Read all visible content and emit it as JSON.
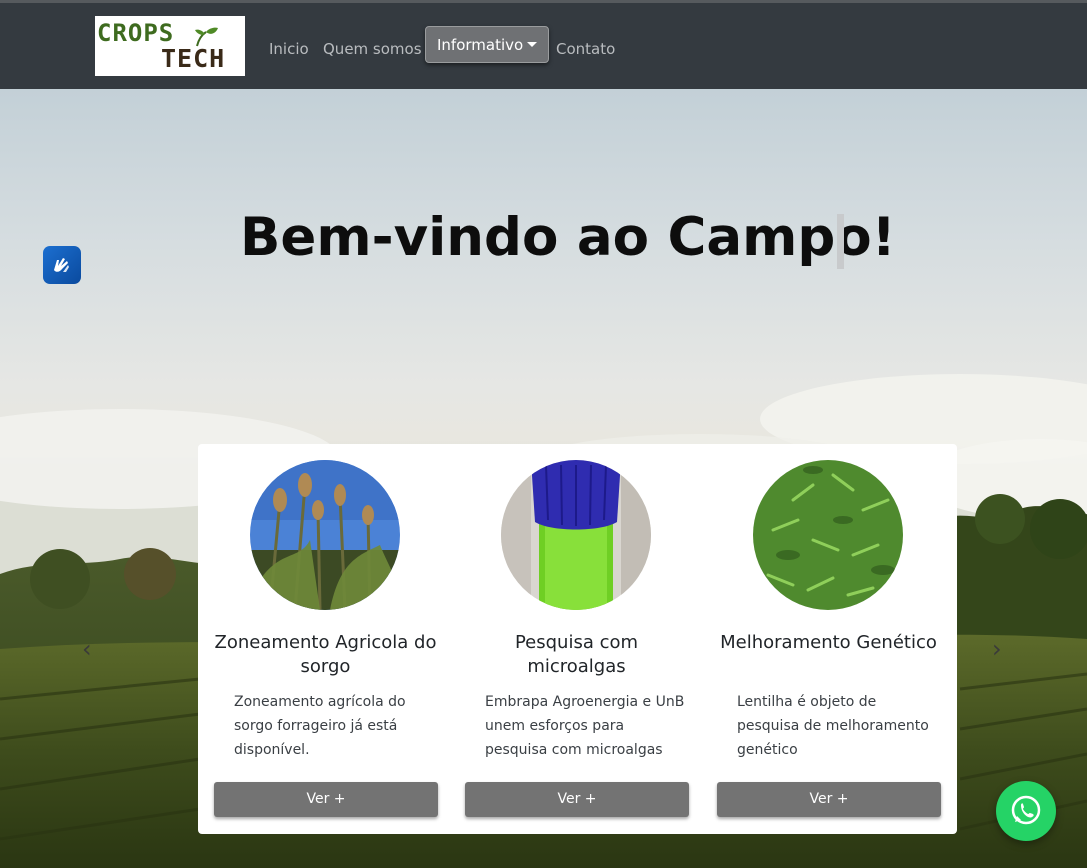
{
  "brand": {
    "line1": "CROPS",
    "line2": "TECH"
  },
  "nav": {
    "inicio": "Inicio",
    "quem_somos": "Quem somos",
    "informativo": "Informativo",
    "contato": "Contato"
  },
  "hero": {
    "title": "Bem-vindo ao Campo!"
  },
  "cards": [
    {
      "title": "Zoneamento Agricola do sorgo",
      "text": "Zoneamento agrícola do sorgo forrageiro já está disponível.",
      "button": "Ver +"
    },
    {
      "title": "Pesquisa com microalgas",
      "text": "Embrapa Agroenergia e UnB unem esforços para pesquisa com microalgas",
      "button": "Ver +"
    },
    {
      "title": "Melhoramento Genético",
      "text": "Lentilha é objeto de pesquisa de melhoramento genético",
      "button": "Ver +"
    }
  ],
  "icons": {
    "accessibility": "sign-language-hands-icon",
    "whatsapp": "whatsapp-icon",
    "carousel_prev": "chevron-left-icon",
    "carousel_next": "chevron-right-icon"
  },
  "colors": {
    "navbar": "#343a40",
    "button": "#737373",
    "whatsapp": "#25d366",
    "accessibility": "#1c6fd0"
  }
}
